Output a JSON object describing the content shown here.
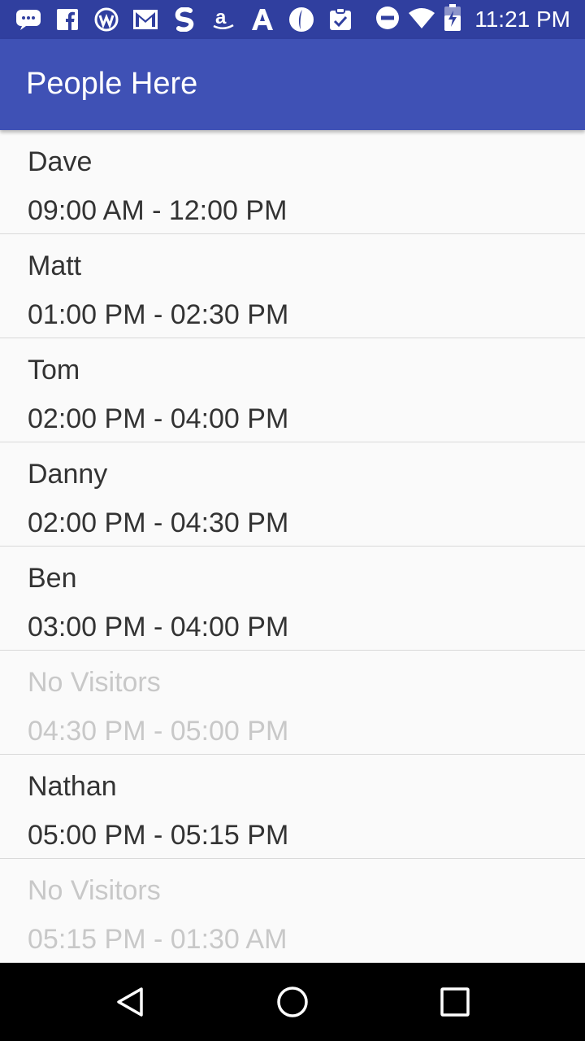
{
  "status_bar": {
    "time": "11:21 PM",
    "left_icons": [
      "messages-icon",
      "facebook-icon",
      "wordpress-icon",
      "gmail-icon",
      "shazam-icon",
      "amazon-icon",
      "font-a-icon",
      "location-icon",
      "clipboard-check-icon"
    ],
    "right_icons": [
      "do-not-disturb-icon",
      "wifi-icon",
      "battery-charging-icon"
    ]
  },
  "app_bar": {
    "title": "People Here",
    "color": "#3f51b5"
  },
  "visits": [
    {
      "name": "Dave",
      "time": "09:00 AM - 12:00 PM",
      "empty": false
    },
    {
      "name": "Matt",
      "time": "01:00 PM - 02:30 PM",
      "empty": false
    },
    {
      "name": "Tom",
      "time": "02:00 PM - 04:00 PM",
      "empty": false
    },
    {
      "name": "Danny",
      "time": "02:00 PM - 04:30 PM",
      "empty": false
    },
    {
      "name": "Ben",
      "time": "03:00 PM - 04:00 PM",
      "empty": false
    },
    {
      "name": "No Visitors",
      "time": "04:30 PM - 05:00 PM",
      "empty": true
    },
    {
      "name": "Nathan",
      "time": "05:00 PM - 05:15 PM",
      "empty": false
    },
    {
      "name": "No Visitors",
      "time": "05:15 PM - 01:30 AM",
      "empty": true
    }
  ],
  "nav_bar": {
    "buttons": [
      "back-icon",
      "home-icon",
      "recents-icon"
    ]
  }
}
